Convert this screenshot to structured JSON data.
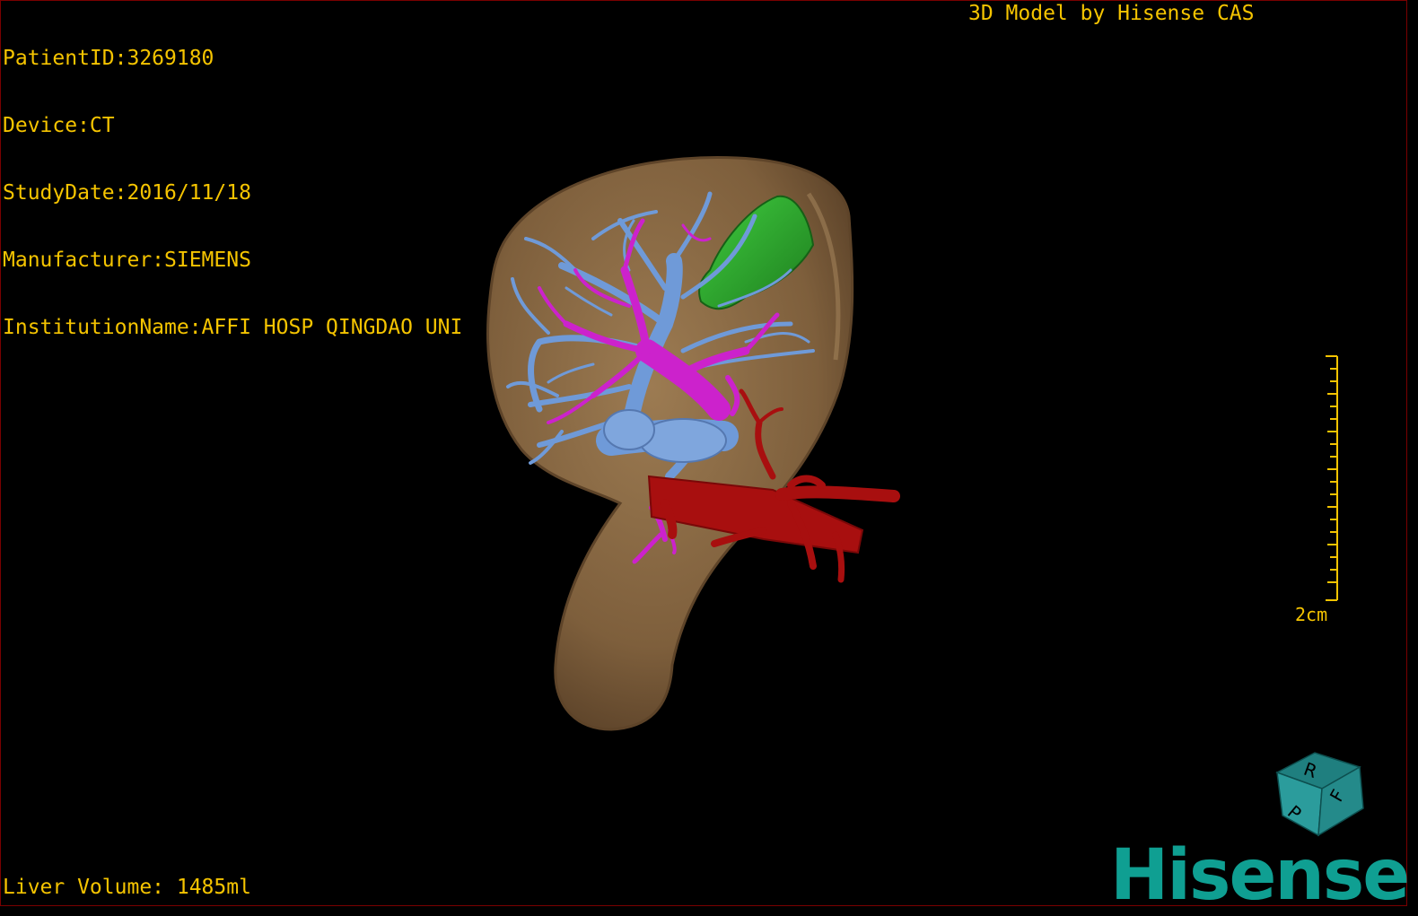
{
  "info": {
    "patient_id": "PatientID:3269180",
    "device": "Device:CT",
    "study_date": "StudyDate:2016/11/18",
    "manufacturer": "Manufacturer:SIEMENS",
    "institution": "InstitutionName:AFFI HOSP QINGDAO UNI"
  },
  "title": "3D Model by Hisense CAS",
  "liver_volume": "Liver Volume: 1485ml",
  "scale_bar": {
    "label": "2cm"
  },
  "orientation_cube": {
    "faces": [
      "R",
      "F",
      "P"
    ]
  },
  "logo": {
    "text": "Hisense"
  },
  "colors": {
    "text": "#f5c400",
    "liver": "#8a6a44",
    "portal_vein": "#6f9ad8",
    "hepatic_vein": "#cc22cc",
    "artery": "#a80f0f",
    "lesion": "#2faa2f",
    "logo": "#0f9f92"
  }
}
